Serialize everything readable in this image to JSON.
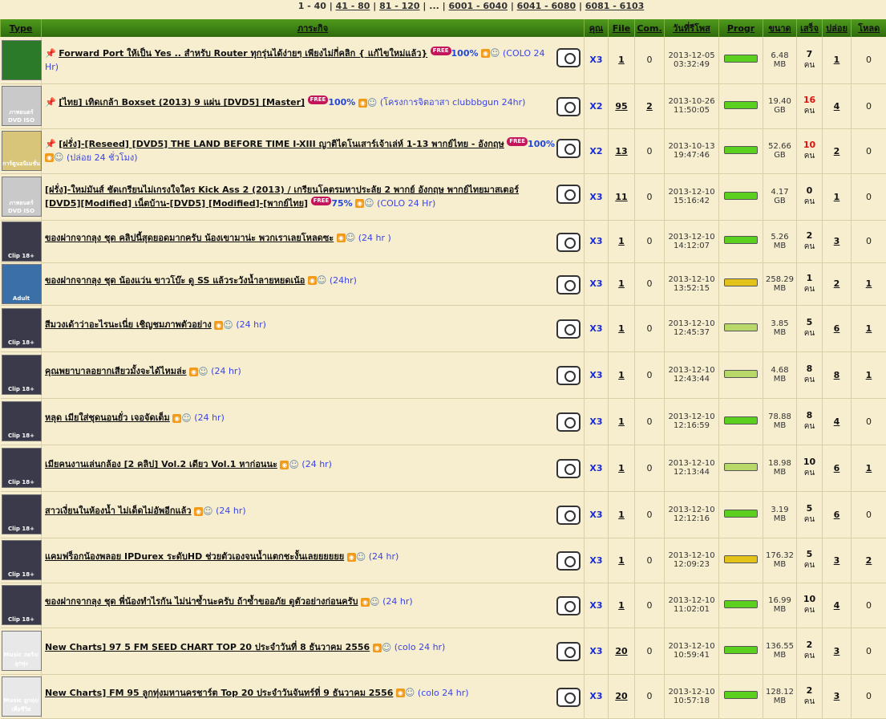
{
  "pager": {
    "current": "1 - 40",
    "links": [
      "41 - 80",
      "81 - 120",
      "...",
      "6001 - 6040",
      "6041 - 6080",
      "6081 - 6103"
    ]
  },
  "headers": [
    "Type",
    "ภาระกิจ",
    "คุณ",
    "File",
    "Com.",
    "วันที่รีโพส",
    "Progr",
    "ขนาด",
    "เสร็จ",
    "ปล่อย",
    "โหลด"
  ],
  "unit": "คน",
  "colors": {
    "header": "#3f7d12",
    "green_bar": "#5bd01f",
    "yellow_bar": "#e3c21a",
    "light_bar": "#b8d86a"
  },
  "rows": [
    {
      "thumb": "",
      "thumb_bg": "#2a7a2a",
      "pin": true,
      "bold": true,
      "title": "Forward Port ให้เป็น Yes .. สำหรับ Router ทุกรุ่นได้ง่ายๆ เพียงไม่กี่คลิก { แก้ไขใหม่แล้ว}",
      "free": "FREE",
      "pct": "100%",
      "note": "(COLO 24 Hr)",
      "cls": "X3",
      "file": "1",
      "com": "0",
      "date": "2013-12-05",
      "time": "03:32:49",
      "bar": "green",
      "size": "6.48",
      "unit": "MB",
      "seed": "7",
      "seed_red": false,
      "leech": "1",
      "dl": "0"
    },
    {
      "thumb": "ภาพยนตร์ DVD ISO",
      "thumb_bg": "#c9c9c9",
      "pin": true,
      "bold": false,
      "title": "[ไทย] เทิดเกล้า Boxset (2013) 9 แผ่น [DVD5] [Master]",
      "free": "FREE",
      "pct": "100%",
      "note": "(โครงการจิตอาสา clubbbgun 24hr)",
      "cls": "X2",
      "file": "95",
      "com": "2",
      "date": "2013-10-26",
      "time": "11:50:05",
      "bar": "green",
      "size": "19.40",
      "unit": "GB",
      "seed": "16",
      "seed_red": true,
      "leech": "4",
      "dl": "0"
    },
    {
      "thumb": "การ์ตูนอนิเมชั่น",
      "thumb_bg": "#d9c57a",
      "pin": true,
      "bold": false,
      "title": "[ฝรั่ง]-[Reseed] [DVD5] THE LAND BEFORE TIME I-XIII ญาติไดโนเสาร์เจ้าเล่ห์ 1-13 พากย์ไทย - อังกฤษ",
      "free": "FREE",
      "pct": "100%",
      "note": "(ปล่อย 24 ชั่วโมง)",
      "cls": "X2",
      "file": "13",
      "com": "0",
      "date": "2013-10-13",
      "time": "19:47:46",
      "bar": "green",
      "size": "52.66",
      "unit": "GB",
      "seed": "10",
      "seed_red": true,
      "leech": "2",
      "dl": "0"
    },
    {
      "thumb": "ภาพยนตร์ DVD ISO",
      "thumb_bg": "#c9c9c9",
      "pin": false,
      "bold": false,
      "title": "[ฝรั่ง]-ใหม่มันส์ ชัดเกรียนไม่เกรงใจใคร Kick Ass 2 (2013) / เกรียนโคตรมหาประลัย 2 พากย์ อังกฤษ พากย์ไทยมาสเตอร์ [DVD5][Modified] เน็ตบ้าน-[DVD5] [Modified]-[พากย์ไทย]",
      "free": "FREE",
      "pct": "75%",
      "note": "(COLO 24 Hr)",
      "cls": "X3",
      "file": "11",
      "com": "0",
      "date": "2013-12-10",
      "time": "15:16:42",
      "bar": "green",
      "size": "4.17",
      "unit": "GB",
      "seed": "0",
      "seed_red": false,
      "leech": "1",
      "dl": "0"
    },
    {
      "thumb": "Clip 18+",
      "thumb_bg": "#3a3a4a",
      "pin": false,
      "bold": false,
      "title": "ของฝากจากลุง ชุด คลิปนี้สุดยอดมากครับ น้องเขามาน่ะ พวกเราเลยโหลดซะ",
      "free": "",
      "pct": "",
      "note": "(24 hr )",
      "cls": "X3",
      "file": "1",
      "com": "0",
      "date": "2013-12-10",
      "time": "14:12:07",
      "bar": "green",
      "size": "5.26",
      "unit": "MB",
      "seed": "2",
      "seed_red": false,
      "leech": "3",
      "dl": "0"
    },
    {
      "thumb": "Adult",
      "thumb_bg": "#3b6fa8",
      "pin": false,
      "bold": false,
      "title": "ของฝากจากลุง ชุด น้องแว่น ขาวโบ๊ะ ดู SS แล้วระวังน้ำลายหยดเน้อ",
      "free": "",
      "pct": "",
      "note": "(24hr)",
      "cls": "X3",
      "file": "1",
      "com": "0",
      "date": "2013-12-10",
      "time": "13:52:15",
      "bar": "yellow",
      "size": "258.29",
      "unit": "MB",
      "seed": "1",
      "seed_red": false,
      "leech": "2",
      "dl": "1"
    },
    {
      "thumb": "Clip 18+",
      "thumb_bg": "#3a3a4a",
      "pin": false,
      "bold": false,
      "title": "สีมวงเด้าว่าอะไรนะเนี่ย เชิญชมภาพตัวอย่าง",
      "free": "",
      "pct": "",
      "note": "(24 hr)",
      "cls": "X3",
      "file": "1",
      "com": "0",
      "date": "2013-12-10",
      "time": "12:45:37",
      "bar": "light",
      "size": "3.85",
      "unit": "MB",
      "seed": "5",
      "seed_red": false,
      "leech": "6",
      "dl": "1"
    },
    {
      "thumb": "Clip 18+",
      "thumb_bg": "#3a3a4a",
      "pin": false,
      "bold": false,
      "title": "คุณพยาบาลอยากเสียวมั้งจะได้ไหมล่ะ",
      "free": "",
      "pct": "",
      "note": "(24 hr)",
      "cls": "X3",
      "file": "1",
      "com": "0",
      "date": "2013-12-10",
      "time": "12:43:44",
      "bar": "light",
      "size": "4.68",
      "unit": "MB",
      "seed": "8",
      "seed_red": false,
      "leech": "8",
      "dl": "1"
    },
    {
      "thumb": "Clip 18+",
      "thumb_bg": "#3a3a4a",
      "pin": false,
      "bold": false,
      "title": "หลุด เมียใส่ชุดนอนยั่ว เจอจัดเต็ม",
      "free": "",
      "pct": "",
      "note": "(24 hr)",
      "cls": "X3",
      "file": "1",
      "com": "0",
      "date": "2013-12-10",
      "time": "12:16:59",
      "bar": "green",
      "size": "78.88",
      "unit": "MB",
      "seed": "8",
      "seed_red": false,
      "leech": "4",
      "dl": "0"
    },
    {
      "thumb": "Clip 18+",
      "thumb_bg": "#3a3a4a",
      "pin": false,
      "bold": false,
      "title": "เมียคนงานเล่นกล้อง [2 คลิป] Vol.2 เดียว Vol.1 หาก่อนนะ",
      "free": "",
      "pct": "",
      "note": "(24 hr)",
      "cls": "X3",
      "file": "1",
      "com": "0",
      "date": "2013-12-10",
      "time": "12:13:44",
      "bar": "light",
      "size": "18.98",
      "unit": "MB",
      "seed": "10",
      "seed_red": false,
      "leech": "6",
      "dl": "1"
    },
    {
      "thumb": "Clip 18+",
      "thumb_bg": "#3a3a4a",
      "pin": false,
      "bold": false,
      "title": "สาวเงี่ยนในห้องน้ำ ไม่เด็ดไม่อัพอีกแล้ว",
      "free": "",
      "pct": "",
      "note": "(24 hr)",
      "cls": "X3",
      "file": "1",
      "com": "0",
      "date": "2013-12-10",
      "time": "12:12:16",
      "bar": "green",
      "size": "3.19",
      "unit": "MB",
      "seed": "5",
      "seed_red": false,
      "leech": "6",
      "dl": "0"
    },
    {
      "thumb": "Clip 18+",
      "thumb_bg": "#3a3a4a",
      "pin": false,
      "bold": false,
      "title": "แคมฟร็อกน้องพลอย IPDurex ระดับHD ช่วยตัวเองจนน้ำแตกชะงั้นเลยยยยยย",
      "free": "",
      "pct": "",
      "note": "(24 hr)",
      "cls": "X3",
      "file": "1",
      "com": "0",
      "date": "2013-12-10",
      "time": "12:09:23",
      "bar": "yellow",
      "size": "176.32",
      "unit": "MB",
      "seed": "5",
      "seed_red": false,
      "leech": "3",
      "dl": "2"
    },
    {
      "thumb": "Clip 18+",
      "thumb_bg": "#3a3a4a",
      "pin": false,
      "bold": false,
      "title": "ของฝากจากลุง ชุด พี่น้องทำไรกัน ไม่น่าซ้ำนะครับ ถ้าซ้ำขออภัย ดูตัวอย่างก่อนครับ",
      "free": "",
      "pct": "",
      "note": "(24 hr)",
      "cls": "X3",
      "file": "1",
      "com": "0",
      "date": "2013-12-10",
      "time": "11:02:01",
      "bar": "green",
      "size": "16.99",
      "unit": "MB",
      "seed": "10",
      "seed_red": false,
      "leech": "4",
      "dl": "0"
    },
    {
      "thumb": "Music สตริง/ลูกทุ่ง",
      "thumb_bg": "#e8e8e8",
      "pin": false,
      "bold": false,
      "title": "New Charts] 97 5 FM SEED CHART TOP 20 ประจำวันที่ 8 ธันวาคม 2556",
      "free": "",
      "pct": "",
      "note": "(colo 24 hr)",
      "cls": "X3",
      "file": "20",
      "com": "0",
      "date": "2013-12-10",
      "time": "10:59:41",
      "bar": "green",
      "size": "136.55",
      "unit": "MB",
      "seed": "2",
      "seed_red": false,
      "leech": "3",
      "dl": "0"
    },
    {
      "thumb": "Music ลูกทุ่ง/เพื่อชีวิต",
      "thumb_bg": "#e8e8e8",
      "pin": false,
      "bold": false,
      "title": "New Charts] FM 95 ลูกทุ่งมหานครชาร์ต Top 20 ประจำวันจันทร์ที่ 9 ธันวาคม 2556",
      "free": "",
      "pct": "",
      "note": "(colo 24 hr)",
      "cls": "X3",
      "file": "20",
      "com": "0",
      "date": "2013-12-10",
      "time": "10:57:18",
      "bar": "green",
      "size": "128.12",
      "unit": "MB",
      "seed": "2",
      "seed_red": false,
      "leech": "3",
      "dl": "0"
    }
  ]
}
